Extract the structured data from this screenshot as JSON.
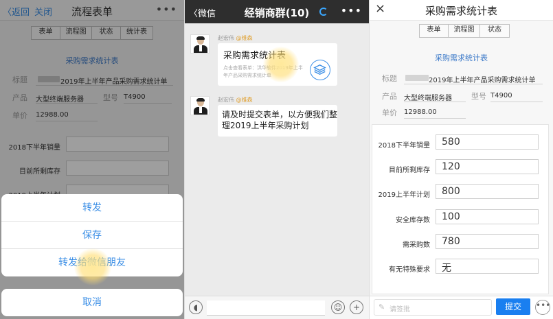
{
  "form_screen": {
    "back_label": "〈返回",
    "close_label": "关闭",
    "title": "流程表单",
    "tabs": [
      "表单",
      "流程图",
      "状态",
      "统计表"
    ],
    "form_title": "采购需求统计表",
    "fields": {
      "title_label": "标题",
      "title_value": "2019年上半年产品采购需求统计单",
      "product_label": "产品",
      "product_value": "大型终端服务器",
      "model_label": "型号",
      "model_value": "T4900",
      "price_label": "单价",
      "price_value": "12988.00"
    },
    "quantity_labels": [
      "2018下半年销量",
      "目前所剩库存",
      "2019上半年计划"
    ],
    "action_sheet": {
      "forward_label": "转发",
      "save_label": "保存",
      "forward_wechat_label": "转发给微信朋友",
      "cancel_label": "取消"
    }
  },
  "chat_screen": {
    "back_label": "〈微信",
    "title": "经销商群(10)",
    "messages": [
      {
        "sender": "赵宏伟",
        "mention": "@维森",
        "card_title": "采购需求统计表",
        "card_desc": "点击查看表单：洪华软件2019年上半年产品采购需求统计单"
      },
      {
        "sender": "赵宏伟",
        "mention": "@维森",
        "text": "请及时提交表单，以方便我们整理2019上半年采购计划"
      }
    ]
  },
  "form_filled_screen": {
    "close_icon": "×",
    "title": "采购需求统计表",
    "tabs": [
      "表单",
      "流程图",
      "状态"
    ],
    "form_title": "采购需求统计表",
    "fields": {
      "title_label": "标题",
      "title_value": "2019年上半年产品采购需求统计单",
      "product_label": "产品",
      "product_value": "大型终端服务器",
      "model_label": "型号",
      "model_value": "T4900",
      "price_label": "单价",
      "price_value": "12988.00"
    },
    "quantities": [
      {
        "label": "2018下半年销量",
        "value": "580"
      },
      {
        "label": "目前所剩库存",
        "value": "120"
      },
      {
        "label": "2019上半年计划",
        "value": "800"
      },
      {
        "label": "安全库存数",
        "value": "100"
      },
      {
        "label": "需采购数",
        "value": "780"
      },
      {
        "label": "有无特殊要求",
        "value": "无"
      }
    ],
    "comment_placeholder": "请签批",
    "submit_label": "提交"
  },
  "colors": {
    "link_blue": "#3a8ee6",
    "form_title_blue": "#3a78c8",
    "submit_blue": "#1a7ff0",
    "chat_header": "#2e2e2e",
    "mention_orange": "#e0a030"
  }
}
